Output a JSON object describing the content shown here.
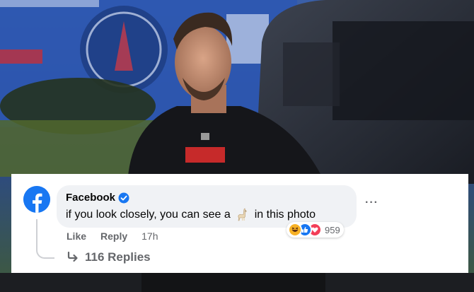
{
  "comment": {
    "author": "Facebook",
    "author_verified": true,
    "text_before": "if you look closely, you can see a",
    "emoji": "llama-emoji",
    "text_after": "in this photo",
    "reaction_count": "959",
    "reaction_types": [
      "haha-reaction-icon",
      "like-reaction-icon",
      "love-reaction-icon"
    ],
    "actions": {
      "like": "Like",
      "reply": "Reply",
      "time": "17h"
    },
    "replies_label": "116 Replies"
  },
  "colors": {
    "brand": "#1877f2",
    "bubble": "#f0f2f5",
    "muted": "#65676b",
    "text": "#050505",
    "love": "#f33e58",
    "haha": "#f7b125"
  }
}
